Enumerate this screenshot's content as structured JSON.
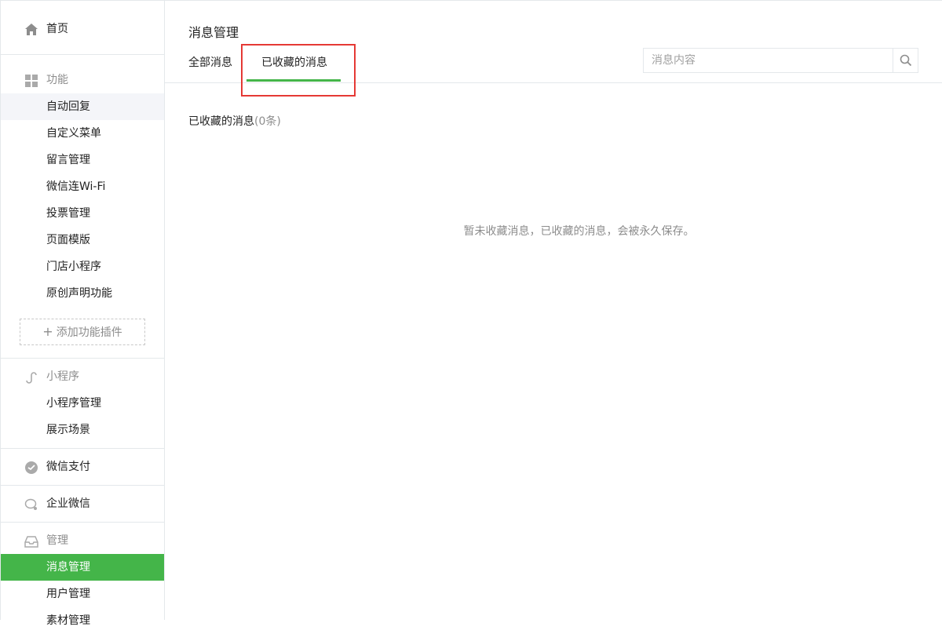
{
  "sidebar": {
    "home_label": "首页",
    "features": {
      "label": "功能",
      "items": [
        "自动回复",
        "自定义菜单",
        "留言管理",
        "微信连Wi-Fi",
        "投票管理",
        "页面模版",
        "门店小程序",
        "原创声明功能"
      ],
      "add_plugin_label": "添加功能插件"
    },
    "miniprogram": {
      "label": "小程序",
      "items": [
        "小程序管理",
        "展示场景"
      ]
    },
    "wechat_pay_label": "微信支付",
    "enterprise_wechat_label": "企业微信",
    "manage": {
      "label": "管理",
      "items": [
        "消息管理",
        "用户管理",
        "素材管理"
      ]
    }
  },
  "main": {
    "title": "消息管理",
    "tabs": [
      {
        "label": "全部消息",
        "selected": false
      },
      {
        "label": "已收藏的消息",
        "selected": true
      }
    ],
    "search": {
      "placeholder": "消息内容"
    },
    "list_title": "已收藏的消息",
    "list_count": "(0条)",
    "empty_message": "暂未收藏消息，已收藏的消息，会被永久保存。"
  },
  "colors": {
    "accent": "#44b549",
    "highlight": "#e53935",
    "border": "#e4e8eb",
    "muted_text": "#8d8d8d"
  }
}
